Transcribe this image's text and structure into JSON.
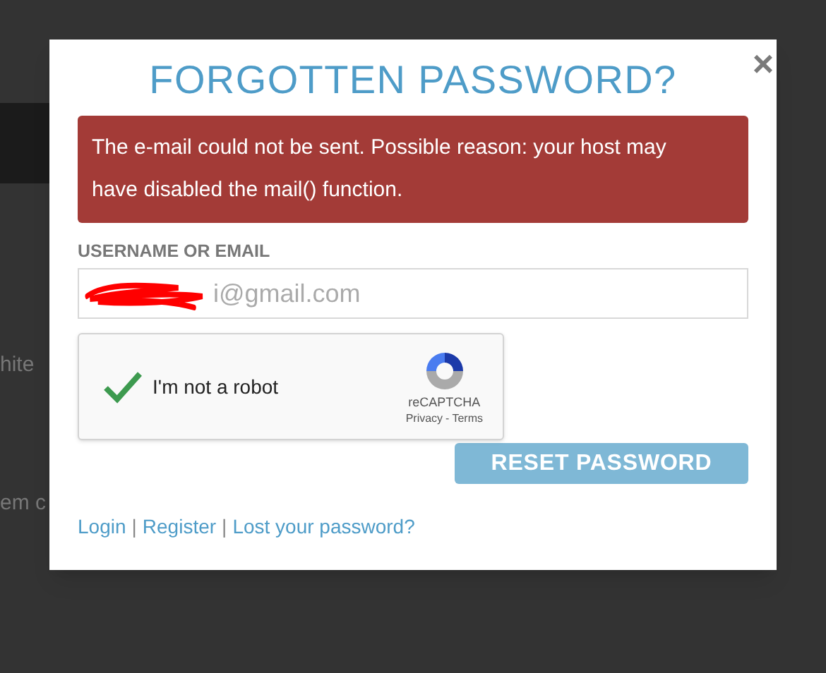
{
  "background": {
    "texts": [
      "hite",
      "em c"
    ]
  },
  "dialog": {
    "title": "FORGOTTEN PASSWORD?",
    "close": "×",
    "error": "The e-mail could not be sent. Possible reason: your host may have disabled the mail() function.",
    "field": {
      "label": "USERNAME OR EMAIL",
      "value": "i@gmail.com",
      "redacted": true
    },
    "captcha": {
      "label": "I'm not a robot",
      "checked": true,
      "brand": "reCAPTCHA",
      "privacy": "Privacy",
      "separator": "-",
      "terms": "Terms"
    },
    "button": "RESET PASSWORD",
    "links": [
      {
        "label": "Login"
      },
      {
        "label": "Register"
      },
      {
        "label": "Lost your password?"
      }
    ],
    "link_separator": "|"
  }
}
